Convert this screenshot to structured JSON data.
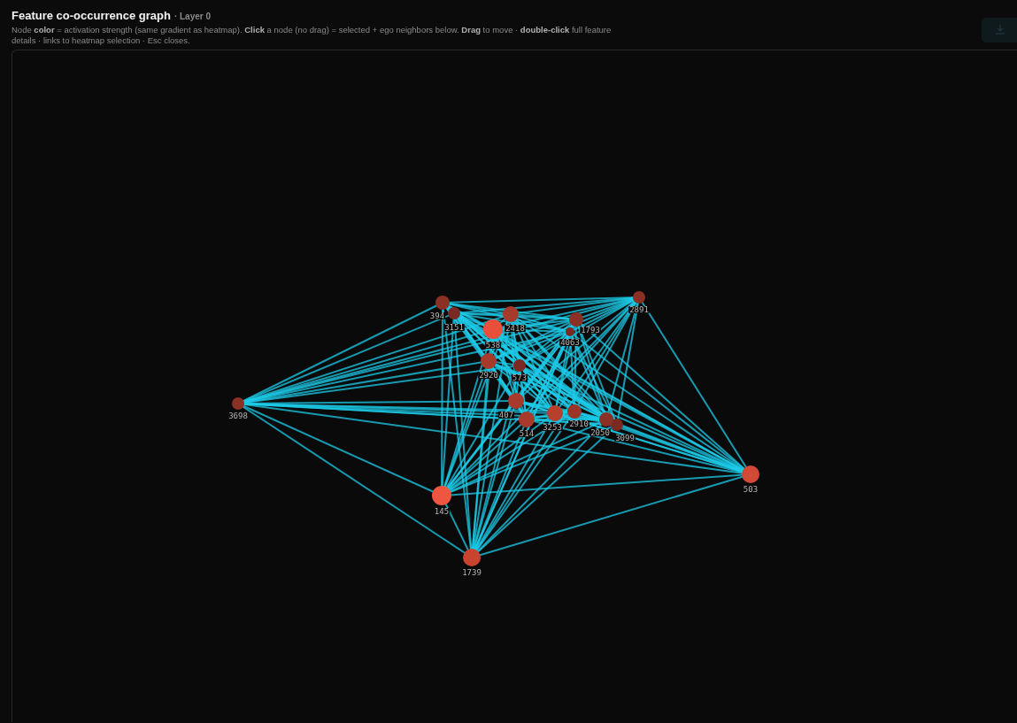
{
  "header": {
    "title": "Feature co-occurrence graph",
    "subtitle": "· Layer 0",
    "description": "Node **color** = activation strength (same gradient as heatmap). **Click** a node (no drag) = selected + ego neighbors below. **Drag** to move · **double-click** full feature details · links to heatmap selection · Esc closes."
  },
  "graph": {
    "nodes": [
      {
        "label": "394",
        "color": "#8b3025"
      },
      {
        "label": "3151",
        "color": "#7a2a22"
      },
      {
        "label": "2418",
        "color": "#a83a2c"
      },
      {
        "label": "538",
        "color": "#e8503c"
      },
      {
        "label": "1793",
        "color": "#8b3025"
      },
      {
        "label": "4063",
        "color": "#7a2a22"
      },
      {
        "label": "2891",
        "color": "#8b3025"
      },
      {
        "label": "2920",
        "color": "#a83a2c"
      },
      {
        "label": "573",
        "color": "#7a2a22"
      },
      {
        "label": "3698",
        "color": "#8b3025"
      },
      {
        "label": "407",
        "color": "#a83a2c"
      },
      {
        "label": "514",
        "color": "#a83a2c"
      },
      {
        "label": "3253",
        "color": "#b83e2e"
      },
      {
        "label": "2910",
        "color": "#9a3528"
      },
      {
        "label": "2050",
        "color": "#8b3025"
      },
      {
        "label": "3099",
        "color": "#7a2a22"
      },
      {
        "label": "145",
        "color": "#f05540"
      },
      {
        "label": "503",
        "color": "#d04a36"
      },
      {
        "label": "1739",
        "color": "#c8442f"
      }
    ]
  }
}
